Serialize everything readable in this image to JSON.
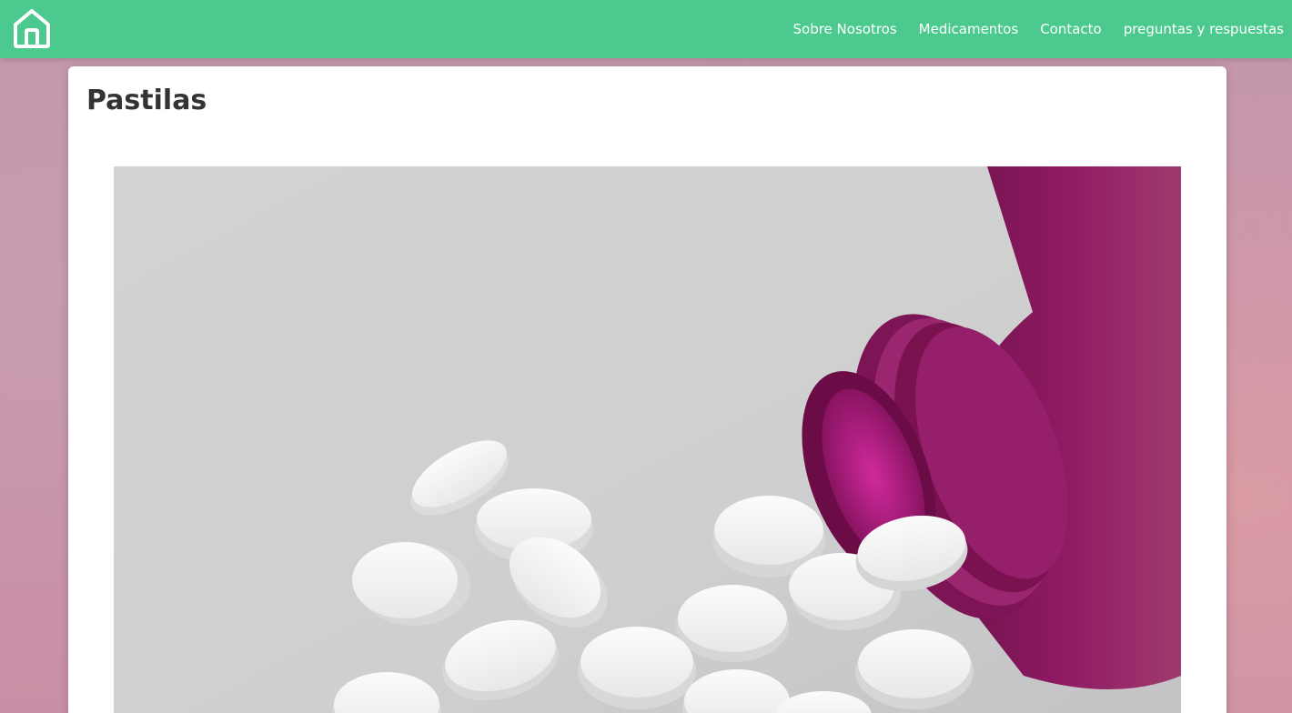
{
  "nav": {
    "home_icon": "home-icon",
    "links": [
      {
        "label": "Sobre Nosotros"
      },
      {
        "label": "Medicamentos"
      },
      {
        "label": "Contacto"
      },
      {
        "label": "preguntas y respuestas"
      }
    ]
  },
  "main": {
    "title": "Pastilas",
    "image_alt": ""
  },
  "colors": {
    "navbar": "#4cc98f",
    "bottle": "#8e1a62",
    "page_background": "#c996ad",
    "title": "#333333"
  }
}
